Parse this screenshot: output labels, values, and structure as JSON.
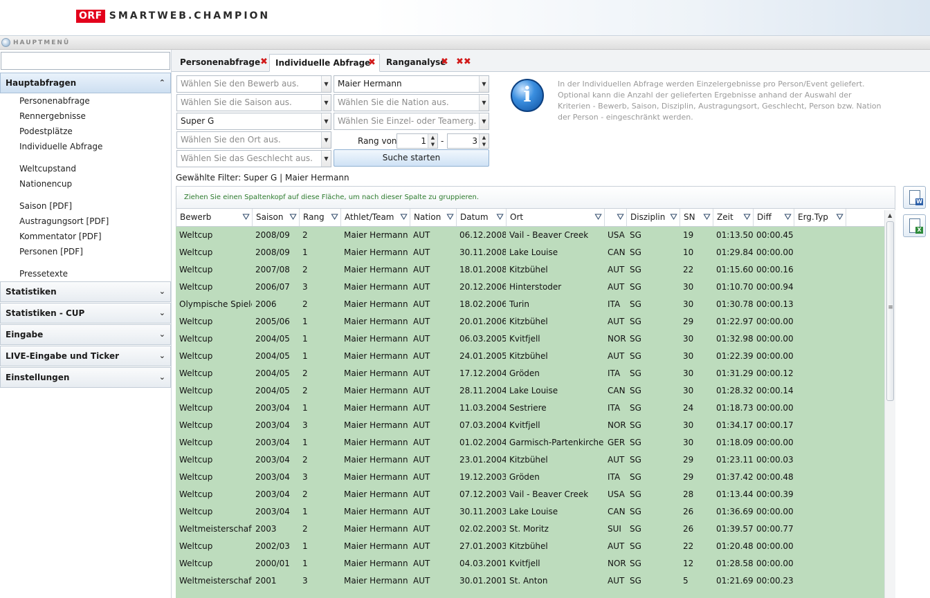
{
  "header": {
    "logo_orf": "ORF",
    "logo_text": "SMARTWEB.CHAMPION"
  },
  "menubar": {
    "label": "HAUPTMENÜ"
  },
  "sidebar": {
    "search_value": "",
    "sections": [
      {
        "label": "Hauptabfragen",
        "open": true
      },
      {
        "label": "Statistiken",
        "open": false
      },
      {
        "label": "Statistiken - CUP",
        "open": false
      },
      {
        "label": "Eingabe",
        "open": false
      },
      {
        "label": "LIVE-Eingabe und Ticker",
        "open": false
      },
      {
        "label": "Einstellungen",
        "open": false
      }
    ],
    "links": [
      "Personenabfrage",
      "Rennergebnisse",
      "Podestplätze",
      "Individuelle Abfrage",
      "Weltcupstand",
      "Nationencup",
      "Saison [PDF]",
      "Austragungsort [PDF]",
      "Kommentator [PDF]",
      "Personen [PDF]",
      "Pressetexte"
    ]
  },
  "tabs": [
    {
      "label": "Personenabfrage",
      "active": false
    },
    {
      "label": "Individuelle Abfrage",
      "active": true
    },
    {
      "label": "Ranganalyse",
      "active": false
    }
  ],
  "tab_close": "✖",
  "tab_close_all": "✖✖",
  "filters": {
    "bewerb": {
      "placeholder": "Wählen Sie den Bewerb aus.",
      "value": ""
    },
    "saison": {
      "placeholder": "Wählen Sie die Saison aus.",
      "value": ""
    },
    "disziplin": {
      "placeholder": "",
      "value": "Super G"
    },
    "ort": {
      "placeholder": "Wählen Sie den Ort aus.",
      "value": ""
    },
    "geschlecht": {
      "placeholder": "Wählen Sie das Geschlecht aus.",
      "value": ""
    },
    "person": {
      "placeholder": "",
      "value": "Maier Hermann"
    },
    "nation": {
      "placeholder": "Wählen Sie die Nation aus.",
      "value": ""
    },
    "typ": {
      "placeholder": "Wählen Sie Einzel- oder Teamerg.",
      "value": ""
    },
    "rang_label": "Rang von",
    "rang_from": "1",
    "rang_dash": "-",
    "rang_to": "3",
    "search_button": "Suche starten",
    "selected_filter": "Gewählte Filter: Super G | Maier Hermann"
  },
  "info_text": "In der Individuellen Abfrage werden Einzelergebnisse pro Person/Event geliefert. Optional kann die Anzahl der gelieferten Ergebnisse anhand der Auswahl der Kriterien - Bewerb, Saison, Disziplin, Austragungsort, Geschlecht, Person bzw. Nation der Person - eingeschränkt werden.",
  "info_icon": "i",
  "grid": {
    "group_hint": "Ziehen Sie einen Spaltenkopf auf diese Fläche, um nach dieser Spalte zu gruppieren.",
    "columns": [
      "Bewerb",
      "Saison",
      "Rang",
      "Athlet/Team",
      "Nation",
      "Datum",
      "Ort",
      "",
      "Disziplin",
      "SN",
      "Zeit",
      "Diff",
      "Erg.Typ"
    ],
    "rows": [
      [
        "Weltcup",
        "2008/09",
        "2",
        "Maier Hermann",
        "AUT",
        "06.12.2008",
        "Vail - Beaver Creek",
        "USA",
        "SG",
        "19",
        "01:13.50",
        "00:00.45",
        ""
      ],
      [
        "Weltcup",
        "2008/09",
        "1",
        "Maier Hermann",
        "AUT",
        "30.11.2008",
        "Lake Louise",
        "CAN",
        "SG",
        "10",
        "01:29.84",
        "00:00.00",
        ""
      ],
      [
        "Weltcup",
        "2007/08",
        "2",
        "Maier Hermann",
        "AUT",
        "18.01.2008",
        "Kitzbühel",
        "AUT",
        "SG",
        "22",
        "01:15.60",
        "00:00.16",
        ""
      ],
      [
        "Weltcup",
        "2006/07",
        "3",
        "Maier Hermann",
        "AUT",
        "20.12.2006",
        "Hinterstoder",
        "AUT",
        "SG",
        "30",
        "01:10.70",
        "00:00.94",
        ""
      ],
      [
        "Olympische Spiele",
        "2006",
        "2",
        "Maier Hermann",
        "AUT",
        "18.02.2006",
        "Turin",
        "ITA",
        "SG",
        "30",
        "01:30.78",
        "00:00.13",
        ""
      ],
      [
        "Weltcup",
        "2005/06",
        "1",
        "Maier Hermann",
        "AUT",
        "20.01.2006",
        "Kitzbühel",
        "AUT",
        "SG",
        "29",
        "01:22.97",
        "00:00.00",
        ""
      ],
      [
        "Weltcup",
        "2004/05",
        "1",
        "Maier Hermann",
        "AUT",
        "06.03.2005",
        "Kvitfjell",
        "NOR",
        "SG",
        "30",
        "01:32.98",
        "00:00.00",
        ""
      ],
      [
        "Weltcup",
        "2004/05",
        "1",
        "Maier Hermann",
        "AUT",
        "24.01.2005",
        "Kitzbühel",
        "AUT",
        "SG",
        "30",
        "01:22.39",
        "00:00.00",
        ""
      ],
      [
        "Weltcup",
        "2004/05",
        "2",
        "Maier Hermann",
        "AUT",
        "17.12.2004",
        "Gröden",
        "ITA",
        "SG",
        "30",
        "01:31.29",
        "00:00.12",
        ""
      ],
      [
        "Weltcup",
        "2004/05",
        "2",
        "Maier Hermann",
        "AUT",
        "28.11.2004",
        "Lake Louise",
        "CAN",
        "SG",
        "30",
        "01:28.32",
        "00:00.14",
        ""
      ],
      [
        "Weltcup",
        "2003/04",
        "1",
        "Maier Hermann",
        "AUT",
        "11.03.2004",
        "Sestriere",
        "ITA",
        "SG",
        "24",
        "01:18.73",
        "00:00.00",
        ""
      ],
      [
        "Weltcup",
        "2003/04",
        "3",
        "Maier Hermann",
        "AUT",
        "07.03.2004",
        "Kvitfjell",
        "NOR",
        "SG",
        "30",
        "01:34.17",
        "00:00.17",
        ""
      ],
      [
        "Weltcup",
        "2003/04",
        "1",
        "Maier Hermann",
        "AUT",
        "01.02.2004",
        "Garmisch-Partenkirchen",
        "GER",
        "SG",
        "30",
        "01:18.09",
        "00:00.00",
        ""
      ],
      [
        "Weltcup",
        "2003/04",
        "2",
        "Maier Hermann",
        "AUT",
        "23.01.2004",
        "Kitzbühel",
        "AUT",
        "SG",
        "29",
        "01:23.11",
        "00:00.03",
        ""
      ],
      [
        "Weltcup",
        "2003/04",
        "3",
        "Maier Hermann",
        "AUT",
        "19.12.2003",
        "Gröden",
        "ITA",
        "SG",
        "29",
        "01:37.42",
        "00:00.48",
        ""
      ],
      [
        "Weltcup",
        "2003/04",
        "2",
        "Maier Hermann",
        "AUT",
        "07.12.2003",
        "Vail - Beaver Creek",
        "USA",
        "SG",
        "28",
        "01:13.44",
        "00:00.39",
        ""
      ],
      [
        "Weltcup",
        "2003/04",
        "1",
        "Maier Hermann",
        "AUT",
        "30.11.2003",
        "Lake Louise",
        "CAN",
        "SG",
        "26",
        "01:36.69",
        "00:00.00",
        ""
      ],
      [
        "Weltmeisterschaft",
        "2003",
        "2",
        "Maier Hermann",
        "AUT",
        "02.02.2003",
        "St. Moritz",
        "SUI",
        "SG",
        "26",
        "01:39.57",
        "00:00.77",
        ""
      ],
      [
        "Weltcup",
        "2002/03",
        "1",
        "Maier Hermann",
        "AUT",
        "27.01.2003",
        "Kitzbühel",
        "AUT",
        "SG",
        "22",
        "01:20.48",
        "00:00.00",
        ""
      ],
      [
        "Weltcup",
        "2000/01",
        "1",
        "Maier Hermann",
        "AUT",
        "04.03.2001",
        "Kvitfjell",
        "NOR",
        "SG",
        "12",
        "01:28.58",
        "00:00.00",
        ""
      ],
      [
        "Weltmeisterschaft",
        "2001",
        "3",
        "Maier Hermann",
        "AUT",
        "30.01.2001",
        "St. Anton",
        "AUT",
        "SG",
        "5",
        "01:21.69",
        "00:00.23",
        ""
      ]
    ]
  },
  "colors": {
    "row_bg": "#bddcbd",
    "tab_close": "#d11a1a",
    "group_hint": "#2d7b2d",
    "logo_red": "#e3001b"
  }
}
